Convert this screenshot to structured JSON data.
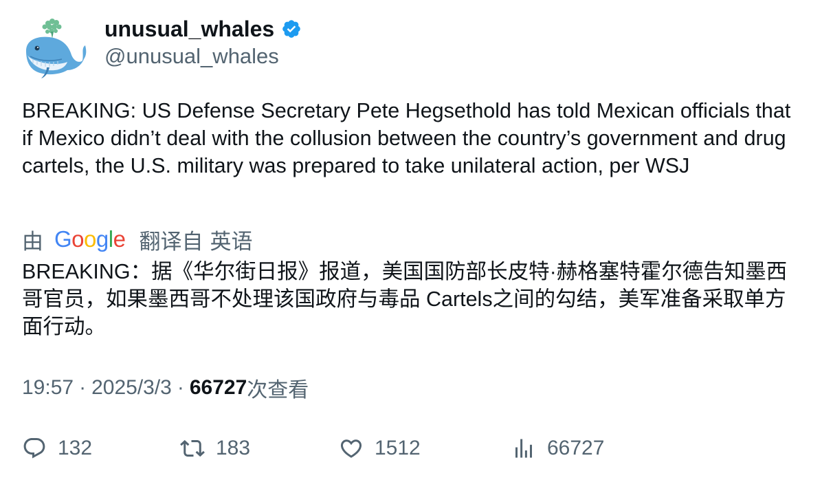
{
  "author": {
    "display_name": "unusual_whales",
    "handle": "@unusual_whales",
    "verified": true,
    "verified_color": "#1d9bf0",
    "avatar_icon": "whale-icon"
  },
  "tweet": {
    "text": "BREAKING: US Defense Secretary Pete Hegsethold has told Mexican officials that if Mexico didn’t deal with the collusion between the country’s government and drug cartels, the U.S. military was prepared to take unilateral action, per WSJ"
  },
  "translation": {
    "by_label": "由",
    "provider": "Google",
    "translated_from_label": "翻译自",
    "source_language": "英语",
    "text": "BREAKING：据《华尔街日报》报道，美国国防部长皮特·赫格塞特霍尔德告知墨西哥官员，如果墨西哥不处理该国政府与毒品 Cartels之间的勾结，美军准备采取单方面行动。"
  },
  "meta": {
    "time": "19:57",
    "separator": "·",
    "date": "2025/3/3",
    "views": "66727",
    "views_label": "次查看"
  },
  "actions": {
    "reply_count": "132",
    "retweet_count": "183",
    "like_count": "1512",
    "views_count": "66727"
  },
  "colors": {
    "text_primary": "#0f1419",
    "text_secondary": "#536471",
    "google_blue": "#4285F4",
    "google_red": "#EA4335",
    "google_yellow": "#FBBC05",
    "google_green": "#34A853"
  }
}
